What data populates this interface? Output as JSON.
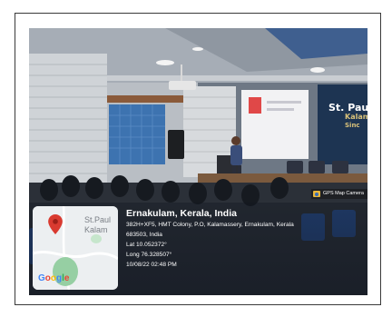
{
  "board": {
    "title": "St. Paul'",
    "line2": "Kalam",
    "line3": "Sinc"
  },
  "gps_badge": {
    "label": "GPS Map Camera",
    "icon": "camera-icon"
  },
  "map": {
    "label_line1": "St.Paul",
    "label_line2": "Kalam",
    "google": [
      "G",
      "o",
      "o",
      "g",
      "l",
      "e"
    ],
    "google_colors": [
      "#4285F4",
      "#EA4335",
      "#FBBC05",
      "#4285F4",
      "#34A853",
      "#EA4335"
    ],
    "pin_color": "#d93a30",
    "pin_icon": "map-pin-icon"
  },
  "location": {
    "place": "Ernakulam, Kerala, India",
    "address_line1": "382H+XF5, HMT Colony, P.O, Kalamassery, Ernakulam, Kerala",
    "address_line2": "683503, India",
    "lat": "Lat 10.052372°",
    "long": "Long 76.328507°",
    "datetime": "10/08/22 02:48 PM"
  }
}
